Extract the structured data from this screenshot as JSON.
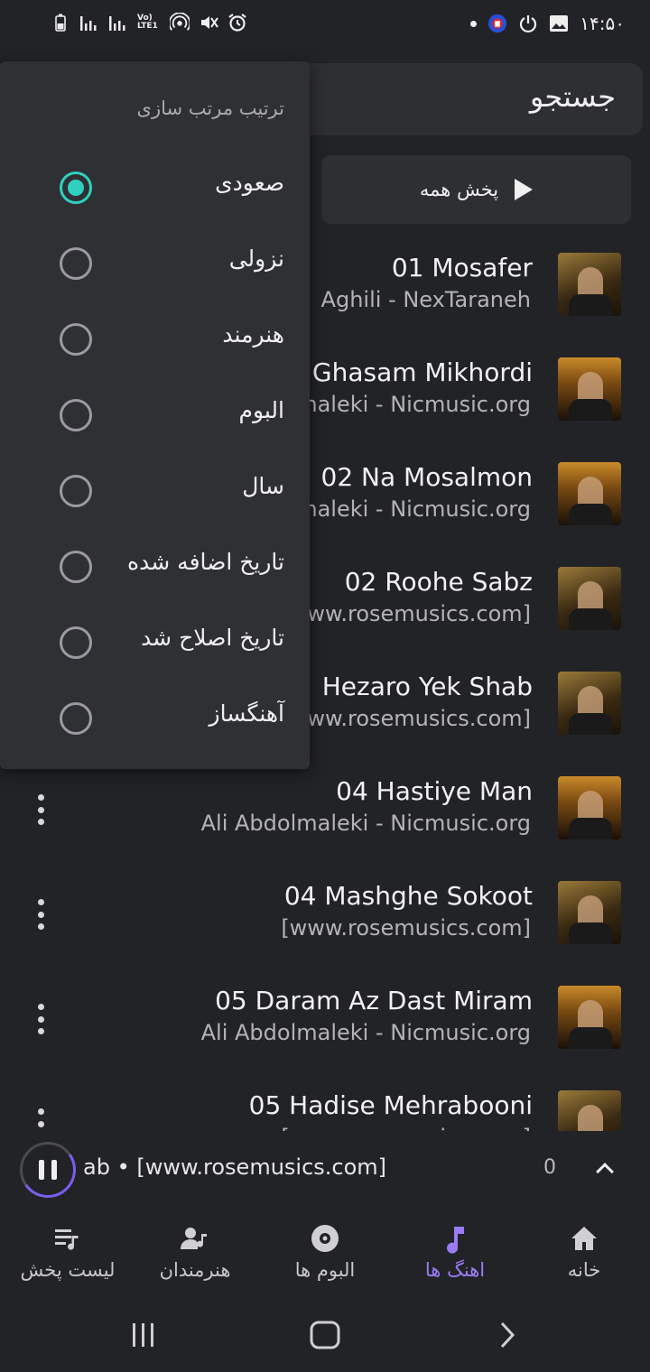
{
  "status_bar": {
    "time": "۱۴:۵۰",
    "left_icons": [
      "battery-icon",
      "signal-icon",
      "signal-icon",
      "volte-icon",
      "hotspot-icon",
      "mute-icon",
      "alarm-icon"
    ],
    "volte_text": "Vo) LTE1",
    "right_icons": [
      "notification-dot",
      "vpn-icon",
      "power-icon",
      "image-icon"
    ]
  },
  "search": {
    "label": "جستجو"
  },
  "play_all": {
    "label": "پخش همه"
  },
  "songs": [
    {
      "title": "01 Mosafer",
      "subtitle": "Aghili - NexTaraneh",
      "thumb": "a"
    },
    {
      "title": "Ghasam Mikhordi",
      "subtitle": "maleki - Nicmusic.org",
      "thumb": "b"
    },
    {
      "title": "02 Na Mosalmon",
      "subtitle": "maleki - Nicmusic.org",
      "thumb": "b"
    },
    {
      "title": "02 Roohe Sabz",
      "subtitle": "ww.rosemusics.com]",
      "thumb": "a"
    },
    {
      "title": "Hezaro Yek Shab",
      "subtitle": "ww.rosemusics.com]",
      "thumb": "a"
    },
    {
      "title": "04 Hastiye Man",
      "subtitle": "Ali Abdolmaleki - Nicmusic.org",
      "thumb": "b"
    },
    {
      "title": "04 Mashghe Sokoot",
      "subtitle": "[www.rosemusics.com]",
      "thumb": "a"
    },
    {
      "title": "05 Daram Az Dast Miram",
      "subtitle": "Ali Abdolmaleki - Nicmusic.org",
      "thumb": "b"
    },
    {
      "title": "05 Hadise Mehrabooni",
      "subtitle": "[www.rosemusics.com]",
      "thumb": "a"
    }
  ],
  "mini_player": {
    "text": "ab • [www.rosemusics.com]",
    "count": "0",
    "progress": 0.3
  },
  "bottom_nav": [
    {
      "label": "خانه",
      "icon": "home-icon",
      "active": false
    },
    {
      "label": "اهنگ ها",
      "icon": "music-note-icon",
      "active": true
    },
    {
      "label": "البوم ها",
      "icon": "album-icon",
      "active": false
    },
    {
      "label": "هنرمندان",
      "icon": "artist-icon",
      "active": false
    },
    {
      "label": "لیست پخش",
      "icon": "playlist-icon",
      "active": false
    }
  ],
  "sort_menu": {
    "title": "ترتیب مرتب سازی",
    "options": [
      {
        "label": "صعودی",
        "selected": true
      },
      {
        "label": "نزولی",
        "selected": false
      },
      {
        "label": "هنرمند",
        "selected": false
      },
      {
        "label": "البوم",
        "selected": false
      },
      {
        "label": "سال",
        "selected": false
      },
      {
        "label": "تاریخ اضافه شده",
        "selected": false
      },
      {
        "label": "تاریخ اصلاح شد",
        "selected": false
      },
      {
        "label": "آهنگساز",
        "selected": false
      }
    ]
  },
  "colors": {
    "accent": "#9b7cf5",
    "radio_selected": "#2fd0c0",
    "background": "#222326",
    "surface": "#2e2f33"
  }
}
